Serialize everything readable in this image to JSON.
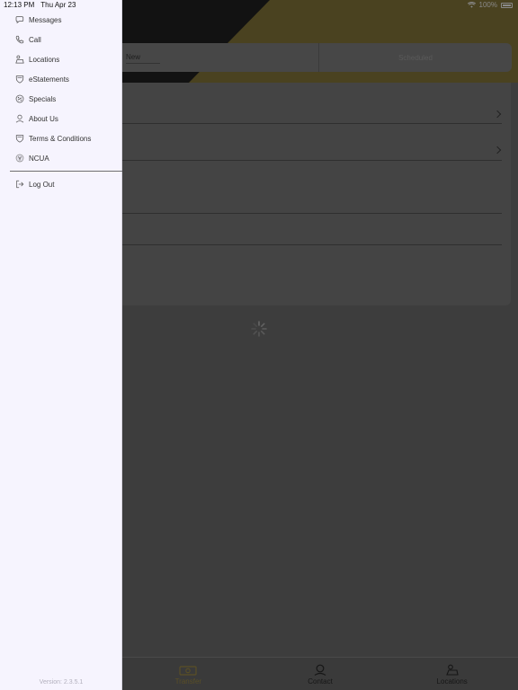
{
  "status": {
    "time": "12:13 PM",
    "date": "Thu Apr 23",
    "battery": "100%"
  },
  "segment": {
    "left_label": "New",
    "right_label": "Scheduled"
  },
  "drawer": {
    "items": [
      {
        "label": "Messages",
        "icon": "chat-bubble-icon"
      },
      {
        "label": "Call",
        "icon": "phone-icon"
      },
      {
        "label": "Locations",
        "icon": "map-location-icon"
      },
      {
        "label": "eStatements",
        "icon": "shield-icon"
      },
      {
        "label": "Specials",
        "icon": "badge-icon"
      },
      {
        "label": "About Us",
        "icon": "person-icon"
      },
      {
        "label": "Terms & Conditions",
        "icon": "shield-icon"
      },
      {
        "label": "NCUA",
        "icon": "ncua-icon"
      }
    ],
    "logout_label": "Log Out",
    "version": "Version: 2.3.5.1"
  },
  "tabbar": [
    {
      "label": "Transfer",
      "icon": "money-transfer-icon"
    },
    {
      "label": "Contact",
      "icon": "contact-icon"
    },
    {
      "label": "Locations",
      "icon": "map-location-icon"
    }
  ]
}
